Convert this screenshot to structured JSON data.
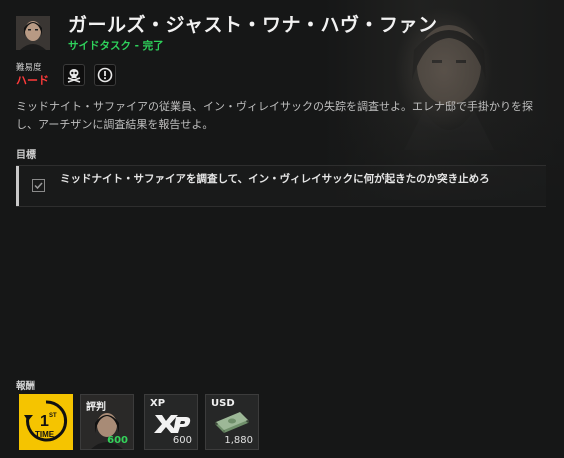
{
  "header": {
    "title": "ガールズ・ジャスト・ワナ・ハヴ・ファン",
    "subtitle_type": "サイドタスク",
    "subtitle_separator": " - ",
    "subtitle_status": "完了"
  },
  "difficulty": {
    "label": "難易度",
    "value": "ハード",
    "icons": [
      "skull-crossbones-icon",
      "exclamation-icon"
    ]
  },
  "description": "ミッドナイト・サファイアの従業員、イン・ヴィレイサックの失踪を調査せよ。エレナ邸で手掛かりを探し、アーチザンに調査結果を報告せよ。",
  "objectives": {
    "heading": "目標",
    "items": [
      {
        "text": "ミッドナイト・サファイアを調査して、イン・ヴィレイサックに何が起きたのか突き止めろ",
        "completed": true
      }
    ]
  },
  "rewards": {
    "heading": "報酬",
    "items": [
      {
        "type": "first-time",
        "badge_line1": "1",
        "badge_sup": "ST",
        "badge_line2": "TIME",
        "color": "#f5c400"
      },
      {
        "type": "reputation",
        "label": "評判",
        "value": "600",
        "value_color": "#34d35b"
      },
      {
        "type": "xp",
        "label": "XP",
        "value": "600"
      },
      {
        "type": "usd",
        "label": "USD",
        "value": "1,880"
      }
    ]
  },
  "colors": {
    "completed_green": "#2ed15b",
    "hard_red": "#ff3a3a",
    "accent_yellow": "#f5c400"
  }
}
